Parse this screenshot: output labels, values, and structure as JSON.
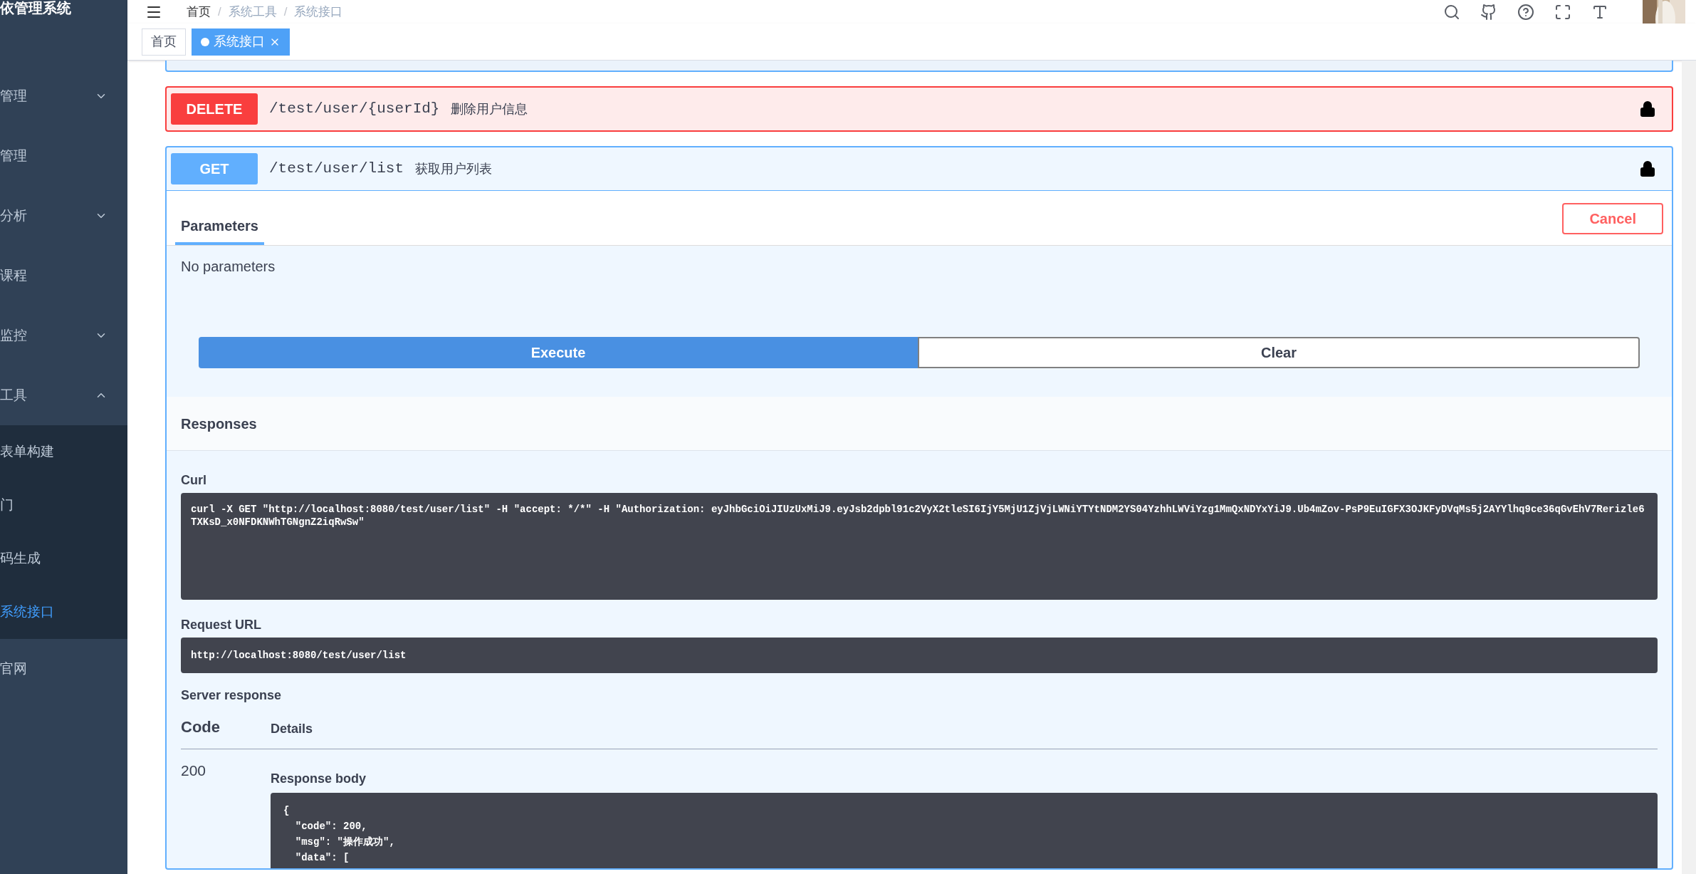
{
  "app": {
    "title": "依管理系统"
  },
  "sidebar": {
    "items": [
      {
        "kind": "submenu",
        "label": "管理",
        "expanded": false
      },
      {
        "kind": "item",
        "label": "管理"
      },
      {
        "kind": "submenu",
        "label": "分析",
        "expanded": false
      },
      {
        "kind": "item",
        "label": "课程"
      },
      {
        "kind": "submenu",
        "label": "监控",
        "expanded": false
      },
      {
        "kind": "submenu",
        "label": "工具",
        "expanded": true,
        "children": [
          {
            "label": "表单构建",
            "selected": false
          },
          {
            "label": "门",
            "selected": false
          },
          {
            "label": "码生成",
            "selected": false
          },
          {
            "label": "系统接口",
            "selected": true
          }
        ]
      },
      {
        "kind": "item",
        "label": "官网"
      }
    ]
  },
  "breadcrumb": [
    {
      "kind": "link",
      "text": "首页"
    },
    {
      "kind": "separator",
      "text": "/"
    },
    {
      "kind": "link",
      "text": "系统工具"
    },
    {
      "kind": "separator",
      "text": "/"
    },
    {
      "kind": "current",
      "text": "系统接口"
    }
  ],
  "tabs": [
    {
      "label": "首页",
      "selected": false
    },
    {
      "label": "系统接口",
      "selected": true
    }
  ],
  "operations": [
    {
      "method": "DELETE",
      "color": "#f93e3e",
      "path": "/test/user/{userId}",
      "summary": "删除用户信息"
    },
    {
      "method": "GET",
      "color": "#61affe",
      "path": "/test/user/list",
      "summary": "获取用户列表",
      "details": {
        "tab": "Parameters",
        "cancel": "Cancel",
        "no_params": "No parameters",
        "execute": "Execute",
        "clear": "Clear",
        "responses_title": "Responses",
        "curl_label": "Curl",
        "curl": "curl -X GET \"http://localhost:8080/test/user/list\" -H \"accept: */*\" -H \"Authorization: eyJhbGciOiJIUzUxMiJ9.eyJsb2dpbl91c2VyX2tleSI6IjY5MjU1ZjVjLWNiYTYtNDM2YS04YzhhLWViYzg1MmQxNDYxYiJ9.Ub4mZov-PsP9EuIGFX3OJKFyDVqMs5j2AYYlhq9ce36qGvEhV7Rerizle6TXKsD_x0NFDKNWhTGNgnZ2iqRwSw\"",
        "request_url_label": "Request URL",
        "request_url": "http://localhost:8080/test/user/list",
        "server_response_label": "Server response",
        "code_header": "Code",
        "details_header": "Details",
        "code": "200",
        "body_label": "Response body",
        "body_lines": [
          "{",
          "  \"code\": 200,",
          "  \"msg\": \"操作成功\",",
          "  \"data\": ["
        ]
      }
    }
  ]
}
